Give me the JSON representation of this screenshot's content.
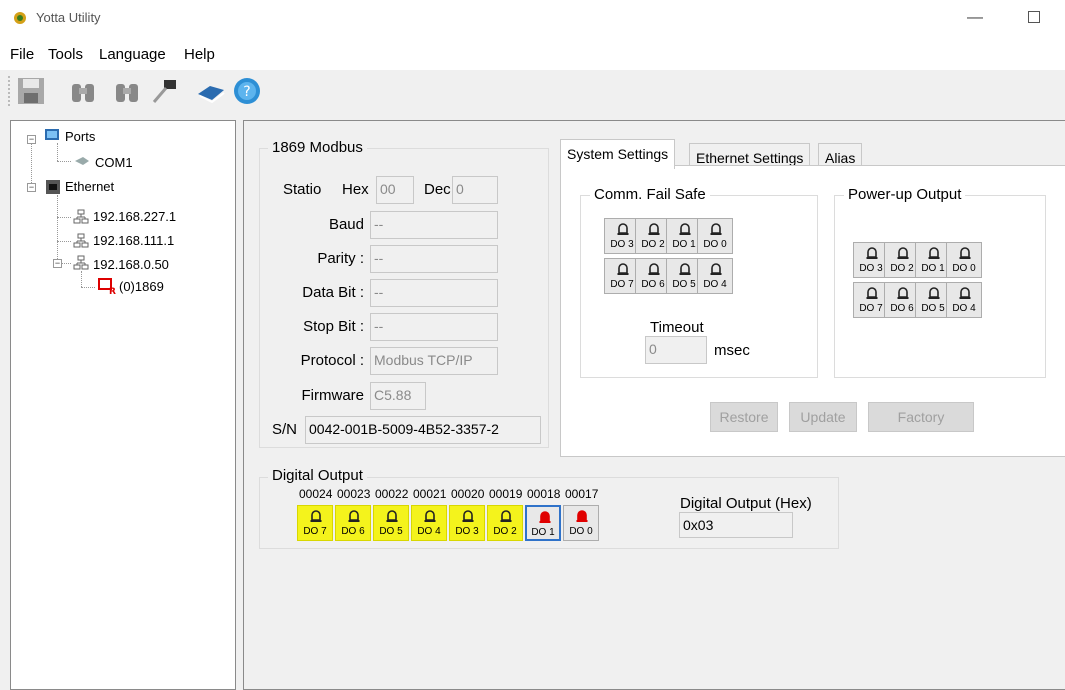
{
  "window": {
    "title": "Yotta Utility",
    "minimize_glyph": "—"
  },
  "menu": [
    "File",
    "Tools",
    "Language",
    "Help"
  ],
  "toolbar": {
    "icons": [
      "save-icon",
      "binoculars-icon",
      "binoculars-next-icon",
      "network-tool-icon",
      "book-icon",
      "help-icon"
    ]
  },
  "tree": {
    "ports_label": "Ports",
    "com_label": "COM1",
    "ethernet_label": "Ethernet",
    "ip1": "192.168.227.1",
    "ip2": "192.168.111.1",
    "ip3": "192.168.0.50",
    "device": "(0)1869"
  },
  "modbus": {
    "group_title": "1869 Modbus",
    "station_label": "Statio",
    "hex_label": "Hex",
    "hex_value": "00",
    "dec_label": "Dec",
    "dec_value": "0",
    "baud_label": "Baud",
    "baud_value": "--",
    "parity_label": "Parity :",
    "parity_value": "--",
    "databit_label": "Data Bit :",
    "databit_value": "--",
    "stopbit_label": "Stop Bit :",
    "stopbit_value": "--",
    "protocol_label": "Protocol :",
    "protocol_value": "Modbus TCP/IP",
    "firmware_label": "Firmware",
    "firmware_value": "C5.88",
    "sn_label": "S/N",
    "sn_value": "0042-001B-5009-4B52-3357-2"
  },
  "tabs": [
    "System Settings",
    "Ethernet Settings",
    "Alias"
  ],
  "system_settings": {
    "comm_title": "Comm. Fail Safe",
    "power_title": "Power-up Output",
    "do_top_row": [
      "DO 3",
      "DO 2",
      "DO 1",
      "DO 0"
    ],
    "do_bottom_row": [
      "DO 7",
      "DO 6",
      "DO 5",
      "DO 4"
    ],
    "timeout_label": "Timeout",
    "timeout_value": "0",
    "timeout_unit": "msec",
    "restore_label": "Restore",
    "update_label": "Update",
    "factory_label": "Factory"
  },
  "digital_output": {
    "group_title": "Digital Output",
    "addresses": [
      "00024",
      "00023",
      "00022",
      "00021",
      "00020",
      "00019",
      "00018",
      "00017"
    ],
    "channels": [
      "DO 7",
      "DO 6",
      "DO 5",
      "DO 4",
      "DO 3",
      "DO 2",
      "DO 1",
      "DO 0"
    ],
    "states": [
      false,
      false,
      false,
      false,
      false,
      false,
      true,
      true
    ],
    "hex_label": "Digital Output (Hex)",
    "hex_value": "0x03"
  },
  "colors": {
    "highlight": "#f4f31c",
    "on_bell": "#e00000",
    "off_bell": "#222222",
    "selected_border": "#2f72c9"
  }
}
